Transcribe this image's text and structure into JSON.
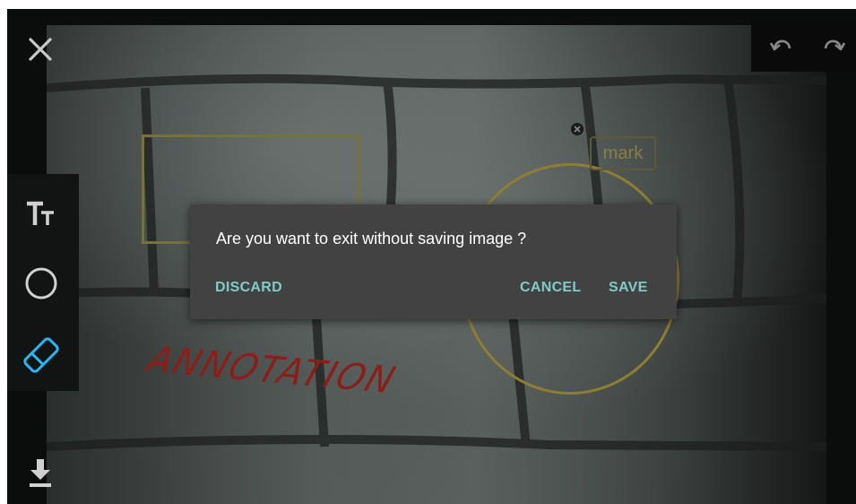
{
  "dialog": {
    "message": "Are you want to exit without saving image ?",
    "discard_label": "DISCARD",
    "cancel_label": "CANCEL",
    "save_label": "SAVE"
  },
  "annotations": {
    "text_annotation": "ANNOTATION",
    "mark_label": "mark"
  },
  "toolbar": {
    "close_icon": "close-icon",
    "text_tool_icon": "text-tool-icon",
    "circle_tool_icon": "circle-tool-icon",
    "eraser_tool_icon": "eraser-tool-icon",
    "download_icon": "download-icon",
    "undo_icon": "undo-icon",
    "redo_icon": "redo-icon"
  },
  "colors": {
    "accent": "#80cbc4",
    "active_tool": "#29b6f6",
    "dialog_bg": "#424242",
    "annotation_red": "#8a1f1a",
    "shape_olive": "#8e7e34"
  }
}
